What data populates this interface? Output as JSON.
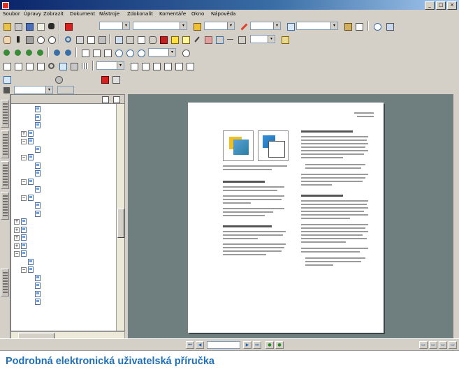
{
  "window": {
    "title": "",
    "buttons": [
      "_",
      "□",
      "×"
    ]
  },
  "menu": [
    {
      "label": "Soubor"
    },
    {
      "label": "Úpravy"
    },
    {
      "label": "Zobrazit"
    },
    {
      "label": "Dokument"
    },
    {
      "label": "Nástroje"
    },
    {
      "label": "Zdokonalit"
    },
    {
      "label": "Komentáře"
    },
    {
      "label": "Okno"
    },
    {
      "label": "Nápověda"
    }
  ],
  "toolbar1": {
    "create_pdf": "",
    "combo_a": "",
    "combo_b": "",
    "combo_c": "",
    "combo_d": ""
  },
  "toolbar3": {
    "zoom": ""
  },
  "toolbar5": {
    "nav_button_a": "",
    "nav_button_b": "",
    "nav_button_c": ""
  },
  "toolbar6": {
    "field": "",
    "button": ""
  },
  "bookmarks": {
    "header": "",
    "items": [
      {
        "text": "",
        "level": 2,
        "expanded": null,
        "selected": false
      },
      {
        "text": "",
        "level": 2,
        "expanded": null,
        "selected": false
      },
      {
        "text": "",
        "level": 2,
        "expanded": null,
        "selected": false
      },
      {
        "text": "",
        "level": 1,
        "expanded": false,
        "selected": false
      },
      {
        "text": "",
        "level": 1,
        "expanded": true,
        "selected": false
      },
      {
        "text": "",
        "level": 2,
        "expanded": null,
        "selected": false
      },
      {
        "text": "",
        "level": 1,
        "expanded": true,
        "selected": false
      },
      {
        "text": "",
        "level": 2,
        "expanded": null,
        "selected": false
      },
      {
        "text": "",
        "level": 2,
        "expanded": null,
        "selected": false
      },
      {
        "text": "",
        "level": 1,
        "expanded": true,
        "selected": false
      },
      {
        "text": "",
        "level": 2,
        "expanded": null,
        "selected": false
      },
      {
        "text": "",
        "level": 1,
        "expanded": true,
        "selected": false
      },
      {
        "text": "",
        "level": 2,
        "expanded": null,
        "selected": true
      },
      {
        "text": "",
        "level": 2,
        "expanded": null,
        "selected": false
      },
      {
        "text": "",
        "level": 0,
        "expanded": false,
        "selected": false
      },
      {
        "text": "",
        "level": 0,
        "expanded": false,
        "selected": false
      },
      {
        "text": "",
        "level": 0,
        "expanded": false,
        "selected": false
      },
      {
        "text": "",
        "level": 0,
        "expanded": false,
        "selected": false
      },
      {
        "text": "",
        "level": 0,
        "expanded": true,
        "selected": false
      },
      {
        "text": "",
        "level": 1,
        "expanded": null,
        "selected": false
      },
      {
        "text": "",
        "level": 1,
        "expanded": true,
        "selected": false
      },
      {
        "text": "",
        "level": 2,
        "expanded": null,
        "selected": false
      },
      {
        "text": "",
        "level": 2,
        "expanded": null,
        "selected": false
      },
      {
        "text": "",
        "level": 2,
        "expanded": null,
        "selected": false
      },
      {
        "text": "",
        "level": 2,
        "expanded": null,
        "selected": false
      }
    ]
  },
  "statusbar": {
    "page_field": "",
    "of_pages": ""
  },
  "caption": "Podrobná elektronická uživatelská příručka",
  "colors": {
    "caption": "#1d6fb8",
    "doc_background": "#6f7f80",
    "titlebar": "#0a246a"
  }
}
